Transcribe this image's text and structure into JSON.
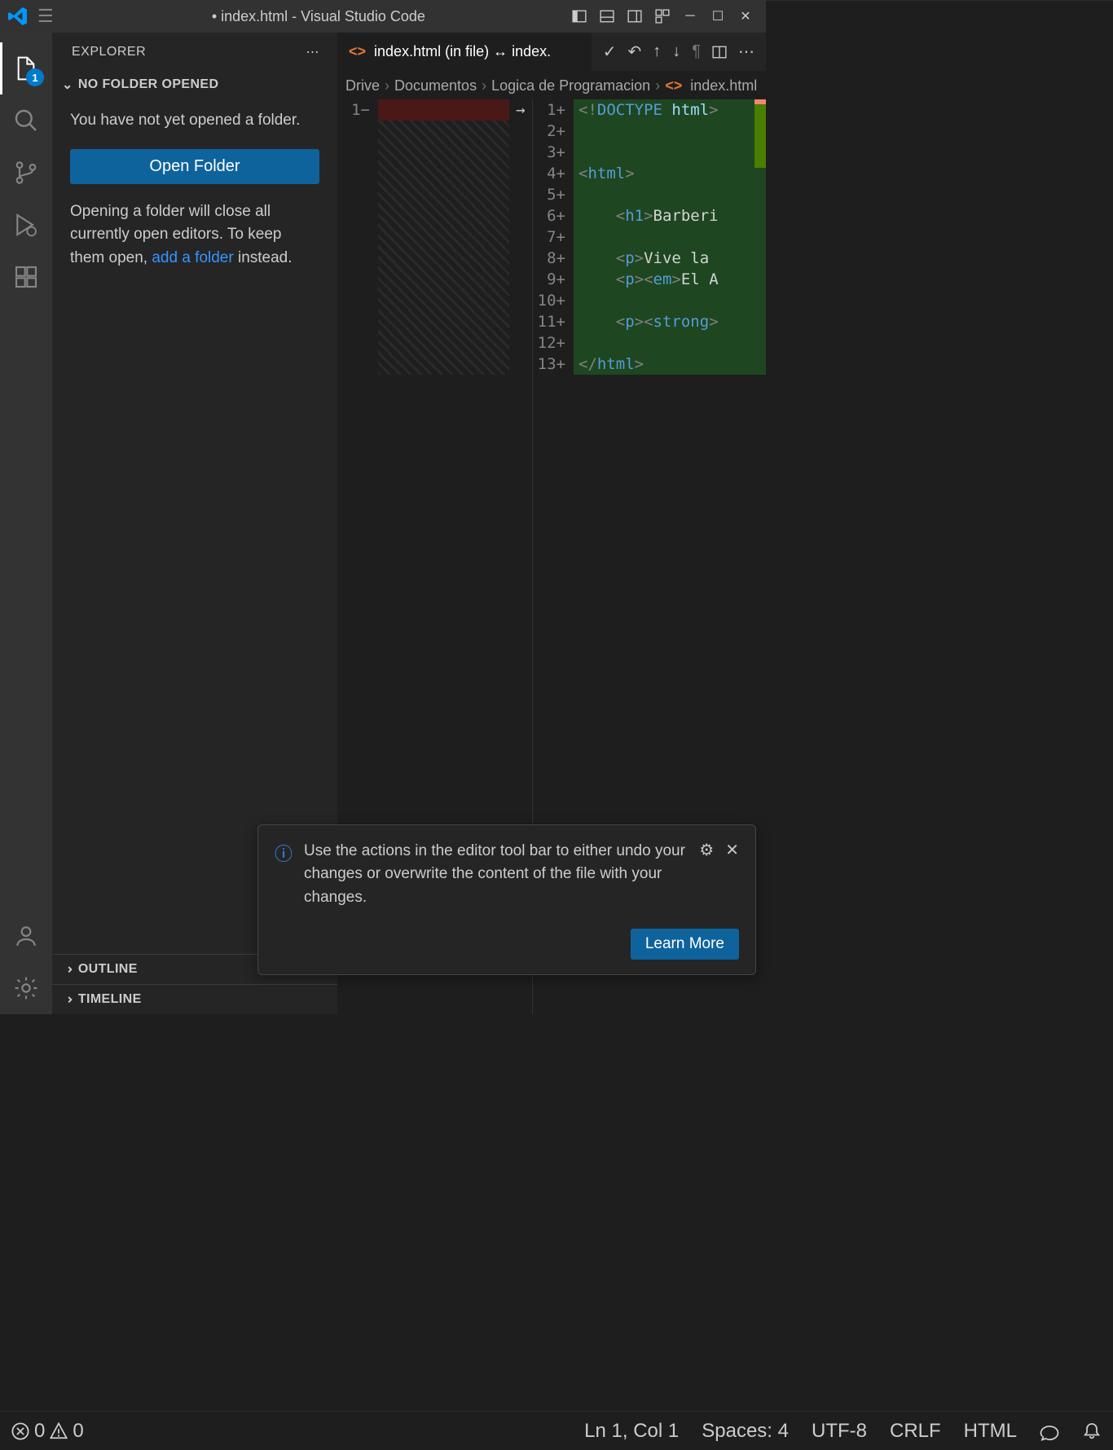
{
  "title": "• index.html - Visual Studio Code",
  "sidebar": {
    "header": "EXPLORER",
    "section": "NO FOLDER OPENED",
    "noFolder": "You have not yet opened a folder.",
    "openFolderBtn": "Open Folder",
    "hint1": "Opening a folder will close all currently open editors. To keep them open, ",
    "addFolderLink": "add a folder",
    "hint2": " instead.",
    "outline": "OUTLINE",
    "timeline": "TIMELINE"
  },
  "activity": {
    "badge": "1"
  },
  "tab": {
    "label": "index.html (in file) ↔ index."
  },
  "breadcrumb": {
    "p1": "Drive",
    "p2": "Documentos",
    "p3": "Logica de Programacion",
    "file": "index.html"
  },
  "diff": {
    "left": {
      "line": "1"
    },
    "right": {
      "lines": [
        "1",
        "2",
        "3",
        "4",
        "5",
        "6",
        "7",
        "8",
        "9",
        "10",
        "11",
        "12",
        "13"
      ],
      "l1_a": "<!",
      "l1_b": "DOCTYPE ",
      "l1_c": "html",
      "l1_d": ">",
      "l4_a": "<",
      "l4_b": "html",
      "l4_c": ">",
      "l6_a": "    <",
      "l6_b": "h1",
      "l6_c": ">",
      "l6_d": "Barberi",
      "l8_a": "    <",
      "l8_b": "p",
      "l8_c": ">",
      "l8_d": "Vive la ",
      "l9_a": "    <",
      "l9_b": "p",
      "l9_c": "><",
      "l9_d": "em",
      "l9_e": ">",
      "l9_f": "El A",
      "l11_a": "    <",
      "l11_b": "p",
      "l11_c": "><",
      "l11_d": "strong",
      "l11_e": ">",
      "l13_a": "</",
      "l13_b": "html",
      "l13_c": ">"
    }
  },
  "notification": {
    "msg": "Use the actions in the editor tool bar to either undo your changes or overwrite the content of the file with your changes.",
    "learn": "Learn More"
  },
  "status": {
    "errors": "0",
    "warnings": "0",
    "pos": "Ln 1, Col 1",
    "spaces": "Spaces: 4",
    "encoding": "UTF-8",
    "eol": "CRLF",
    "lang": "HTML"
  }
}
